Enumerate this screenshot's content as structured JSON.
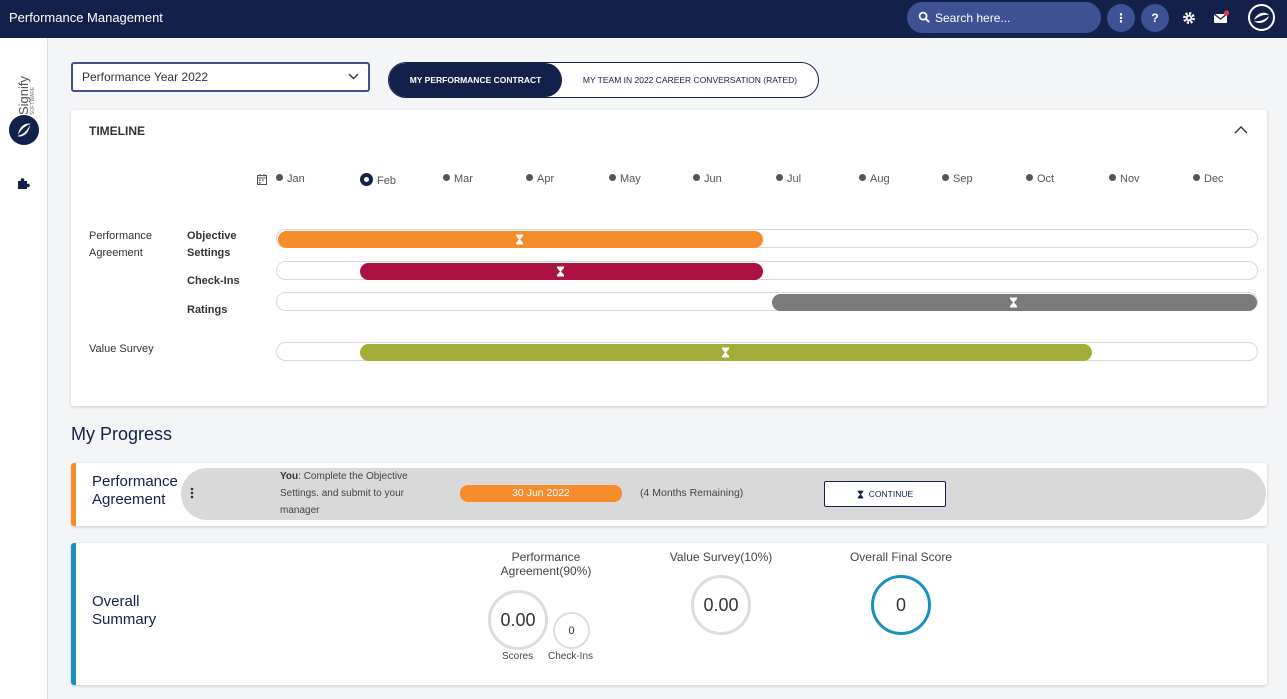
{
  "header": {
    "title": "Performance Management",
    "search_placeholder": "Search here...",
    "more_label": "⋮",
    "help_label": "?"
  },
  "sidebar": {
    "brand_name": "Signify",
    "brand_tagline": "SOFTWARE"
  },
  "year_select": {
    "value": "Performance Year 2022"
  },
  "tabs": [
    {
      "label": "MY PERFORMANCE CONTRACT",
      "active": true
    },
    {
      "label": "MY TEAM IN 2022 CAREER CONVERSATION (RATED)",
      "active": false
    }
  ],
  "timeline": {
    "title": "TIMELINE",
    "months": [
      "Jan",
      "Feb",
      "Mar",
      "Apr",
      "May",
      "Jun",
      "Jul",
      "Aug",
      "Sep",
      "Oct",
      "Nov",
      "Dec"
    ],
    "current_month": "Feb",
    "groups": {
      "performance_agreement": "Performance Agreement",
      "value_survey": "Value Survey"
    },
    "rows": [
      {
        "label": "Objective Settings",
        "color": "#f78c2b"
      },
      {
        "label": "Check-Ins",
        "color": "#ab1141"
      },
      {
        "label": "Ratings",
        "color": "#7a7a7a"
      },
      {
        "label": "",
        "color": "#a4ad37"
      }
    ]
  },
  "progress": {
    "title": "My Progress",
    "performance_agreement": {
      "title": "Performance Agreement",
      "task_prefix": "You",
      "task_text": ": Complete the Objective Settings. and submit to your manager",
      "due_date": "30 Jun 2022",
      "remaining": "(4 Months Remaining)",
      "button": "CONTINUE",
      "accent": "#f78c2b"
    },
    "overall_summary": {
      "title": "Overall Summary",
      "pa_heading": "Performance Agreement(90%)",
      "pa_score": "0.00",
      "pa_score_caption": "Scores",
      "checkins_value": "0",
      "checkins_caption": "Check-Ins",
      "vs_heading": "Value Survey(10%)",
      "vs_score": "0.00",
      "final_heading": "Overall Final Score",
      "final_score": "0",
      "accent": "#1a8fc4"
    }
  }
}
